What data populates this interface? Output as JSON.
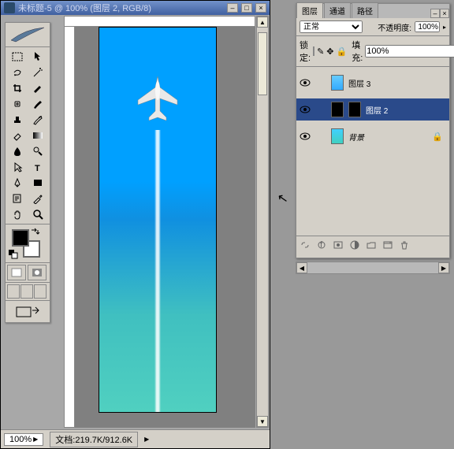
{
  "title": "未标题-5 @ 100% (图层 2, RGB/8)",
  "zoom": "100%",
  "doc_label": "文档:",
  "doc_size": "219.7K/912.6K",
  "panel": {
    "tabs": [
      "图层",
      "通道",
      "路径"
    ],
    "blend_mode": "正常",
    "opacity_label": "不透明度:",
    "opacity_value": "100%",
    "lock_label": "锁定:",
    "fill_label": "填充:",
    "fill_value": "100%"
  },
  "layers": [
    {
      "name": "图层 3",
      "selected": false,
      "bg_style": "linear-gradient(#6cf,#3af)",
      "locked": false
    },
    {
      "name": "图层 2",
      "selected": true,
      "bg_style": "#000",
      "locked": false
    },
    {
      "name": "背景",
      "selected": false,
      "bg_style": "linear-gradient(#40d0ff,#40d0c0)",
      "locked": true
    }
  ]
}
